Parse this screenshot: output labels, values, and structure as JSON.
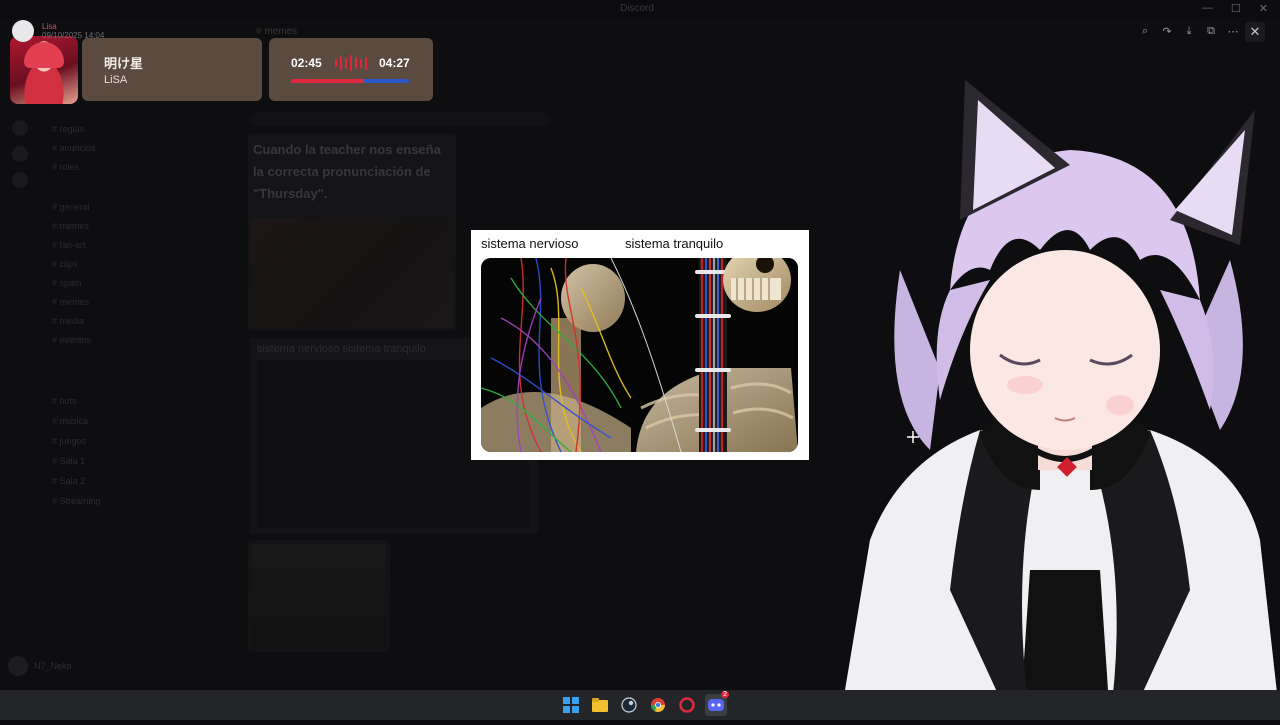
{
  "background_app": {
    "window_title": "Discord",
    "channel_header": "# memes",
    "toolbar_icons": [
      "zoom-icon",
      "share-icon",
      "download-icon",
      "open-external-icon",
      "more-icon"
    ],
    "close_label": "✕",
    "meme1_caption": "Cuando la teacher nos enseña la correcta pronunciación de \"Thursday\".",
    "meme2_caption": "sistema nervioso          sistema tranquilo",
    "sidebar_rows": [
      "# reglas",
      "# anuncios",
      "# roles",
      "# general",
      "# memes",
      "# fan-art",
      "# clips",
      "# spam",
      "# memes",
      "# media",
      "# eventos",
      "# bots",
      "# musica",
      "# juegos",
      "# Sala 1",
      "# Sala 2",
      "# Streaming"
    ],
    "user_name": "N7_Neko"
  },
  "now_playing": {
    "meta_user": "Lisa",
    "meta_date": "09/10/2025 14:04",
    "song_title": "明け星",
    "artist": "LiSA",
    "elapsed": "02:45",
    "total": "04:27",
    "progress": 0.618,
    "accent_color": "#e0283c",
    "track_color": "#2a58c8",
    "card_color": "#5b4a40"
  },
  "meme": {
    "left_label": "sistema nervioso",
    "right_label": "sistema tranquilo"
  },
  "taskbar": {
    "apps": [
      {
        "name": "windows-start-icon",
        "color": "#3aa0f0"
      },
      {
        "name": "file-explorer-icon",
        "color": "#f0c030"
      },
      {
        "name": "steam-icon",
        "color": "#c8d0dc"
      },
      {
        "name": "chrome-icon",
        "color": "#e04030"
      },
      {
        "name": "opera-icon",
        "color": "#e0283c"
      },
      {
        "name": "discord-icon",
        "color": "#5865f2",
        "badge": "2"
      }
    ]
  }
}
